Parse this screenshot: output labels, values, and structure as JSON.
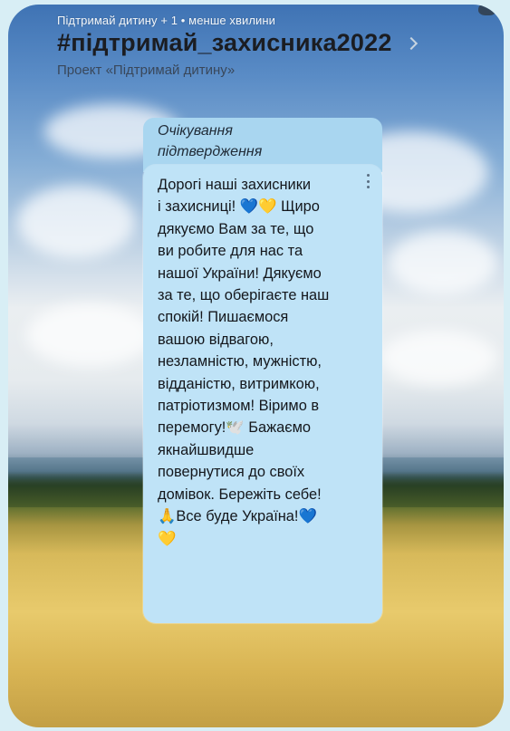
{
  "header": {
    "meta": "Підтримай дитину + 1 • менше хвилини",
    "title": "#підтримай_захисника2022",
    "subtitle": "Проект «Підтримай дитину»"
  },
  "message": {
    "status": "Очікування підтвердження",
    "text": "Дорогі наші захисники\nі захисниці! 💙💛 Щиро\nдякуємо Вам за те, що\nви робите для нас та\nнашої України! Дякуємо\nза те, що оберігаєте наш\nспокій! Пишаємося\nвашою відвагою,\nнезламністю, мужністю,\nвідданістю, витримкою,\nпатріотизмом! Віримо в\nперемогу!🕊️ Бажаємо\nякнайшвидше\nповернутися до своїх\nдомівок. Бережіть себе!\n🙏Все буде Україна!💙\n💛"
  },
  "icons": {
    "more": "more-vertical-icon",
    "chevron": "chevron-right-icon"
  }
}
